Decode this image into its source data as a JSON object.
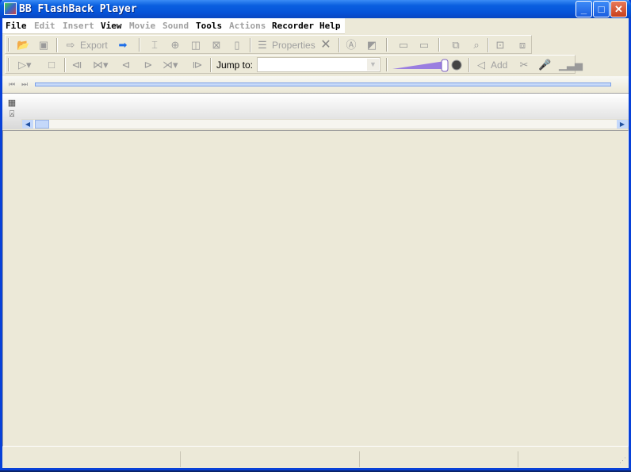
{
  "window": {
    "title": "BB FlashBack Player",
    "min": "_",
    "max": "□",
    "close": "✕"
  },
  "menu": [
    {
      "label": "File",
      "enabled": true
    },
    {
      "label": "Edit",
      "enabled": false
    },
    {
      "label": "Insert",
      "enabled": false
    },
    {
      "label": "View",
      "enabled": true
    },
    {
      "label": "Movie",
      "enabled": false
    },
    {
      "label": "Sound",
      "enabled": false
    },
    {
      "label": "Tools",
      "enabled": true
    },
    {
      "label": "Actions",
      "enabled": false
    },
    {
      "label": "Recorder",
      "enabled": true
    },
    {
      "label": "Help",
      "enabled": true
    }
  ],
  "toolbar": {
    "export": "Export",
    "properties": "Properties",
    "jump_to": "Jump to:",
    "jump_value": "",
    "add": "Add"
  },
  "volume": {
    "level": 1.0,
    "accent": "#9a7ee0"
  }
}
